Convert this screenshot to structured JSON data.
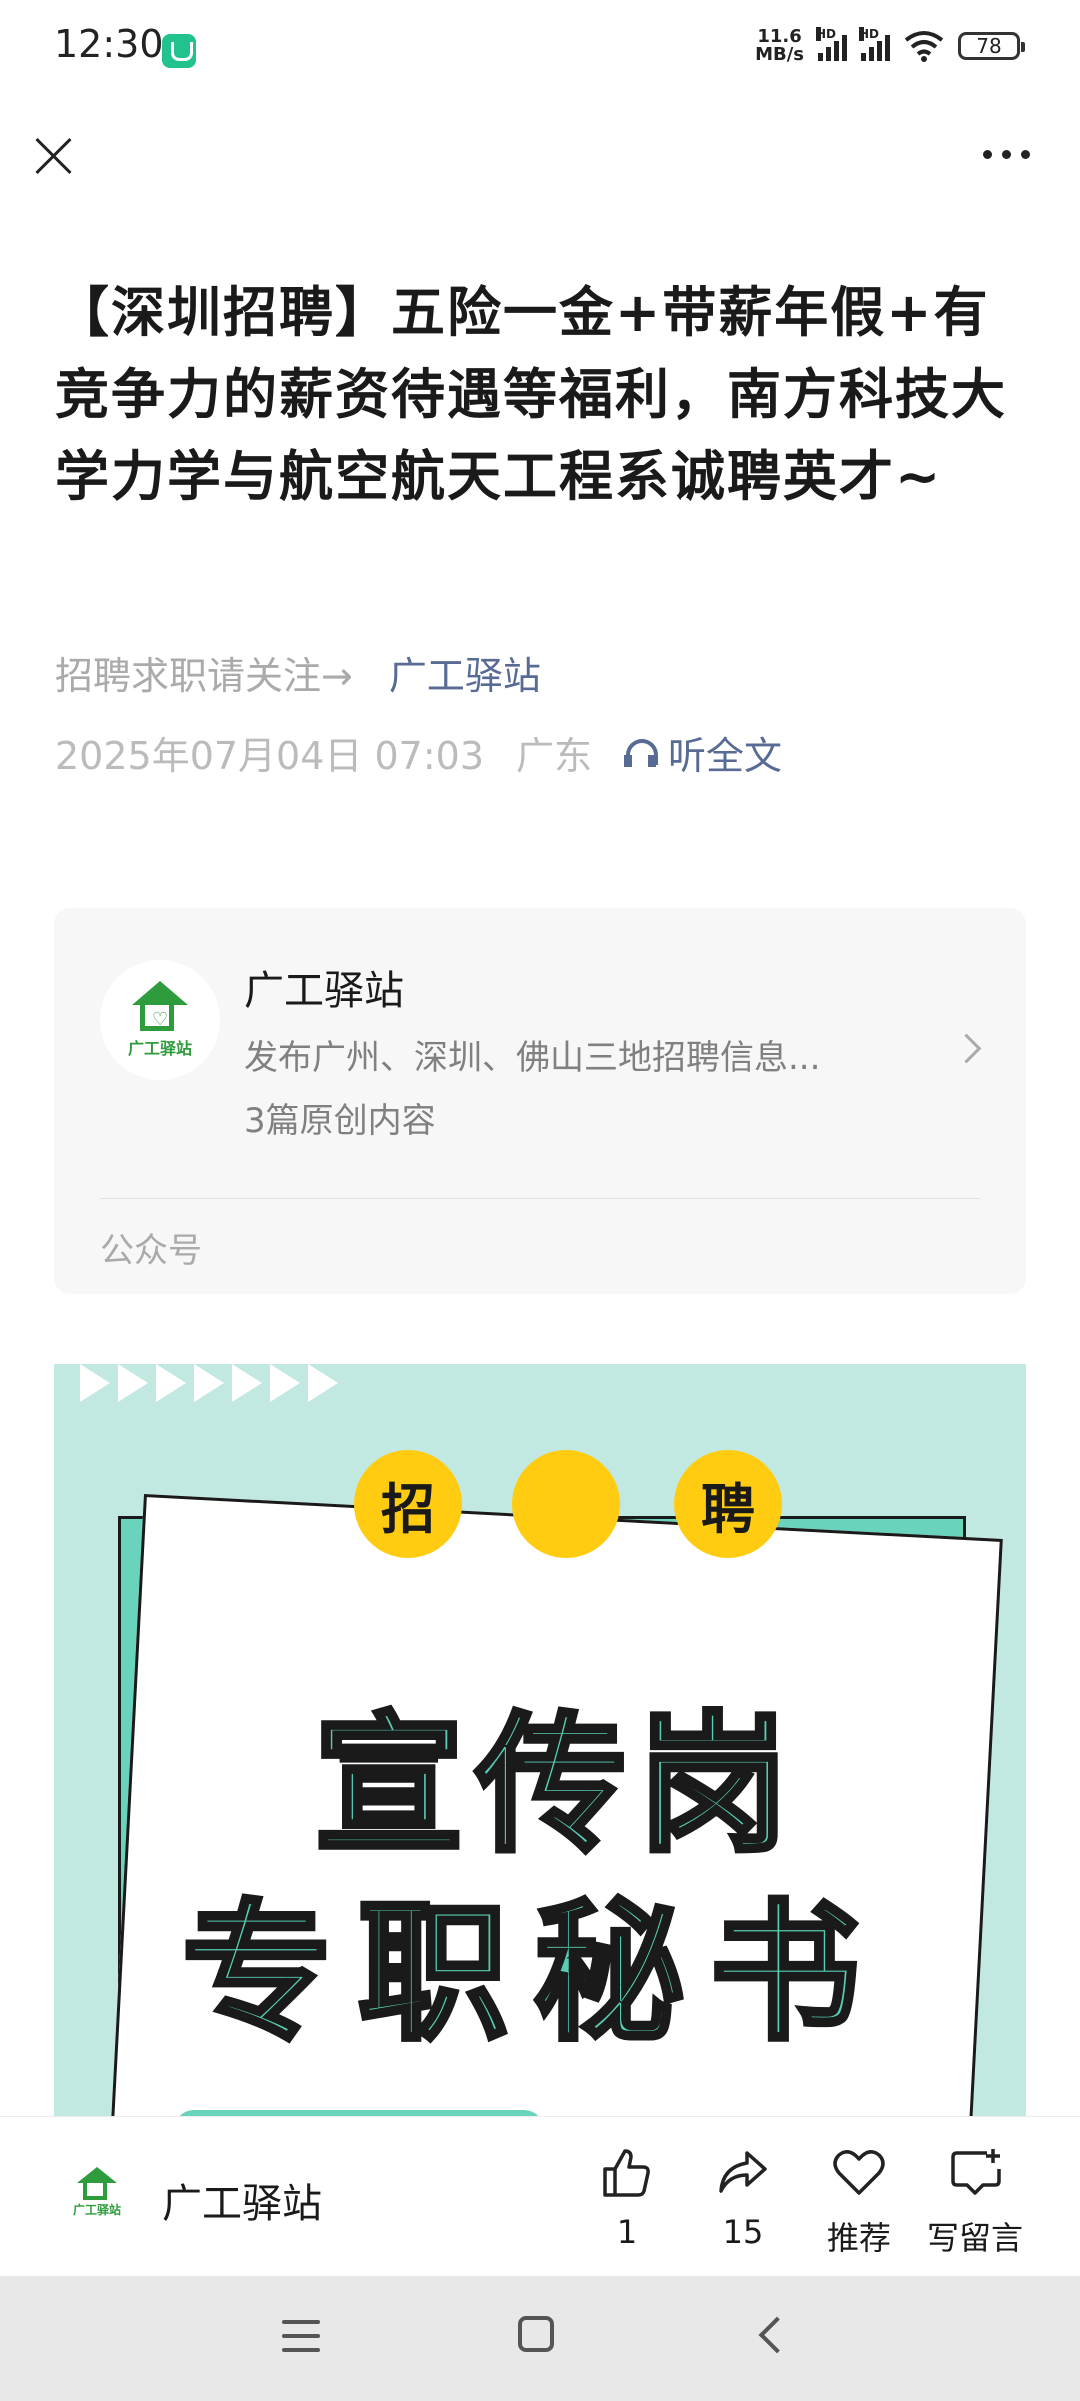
{
  "status_bar": {
    "time": "12:30",
    "net_speed_value": "11.6",
    "net_speed_unit": "MB/s",
    "signal_label": "HD",
    "battery": "78"
  },
  "article": {
    "title": "【深圳招聘】五险一金+带薪年假+有竞争力的薪资待遇等福利，南方科技大学力学与航空航天工程系诚聘英才~",
    "follow_prompt": "招聘求职请关注→",
    "account_link": "广工驿站",
    "datetime": "2025年07月04日 07:03",
    "location": "广东",
    "listen_label": "听全文"
  },
  "account_card": {
    "name": "广工驿站",
    "logo_text": "广工驿站",
    "description": "发布广州、深圳、佛山三地招聘信息...",
    "original_count": "3篇原创内容",
    "type_label": "公众号"
  },
  "poster": {
    "tag_left": "招",
    "tag_right": "聘",
    "line1": "宣传岗",
    "line2": "专职秘书",
    "colors": {
      "background": "#c1e9e2",
      "accent": "#57cdb4",
      "tag": "#ffcc11"
    }
  },
  "bottom_bar": {
    "account_name": "广工驿站",
    "logo_text": "广工驿站",
    "like_count": "1",
    "share_count": "15",
    "recommend_label": "推荐",
    "comment_label": "写留言"
  },
  "icons": [
    "close-icon",
    "more-icon",
    "headphone-icon",
    "chevron-right-icon",
    "thumbs-up-icon",
    "share-icon",
    "heart-icon",
    "comment-icon",
    "menu-icon",
    "home-icon",
    "back-icon"
  ]
}
